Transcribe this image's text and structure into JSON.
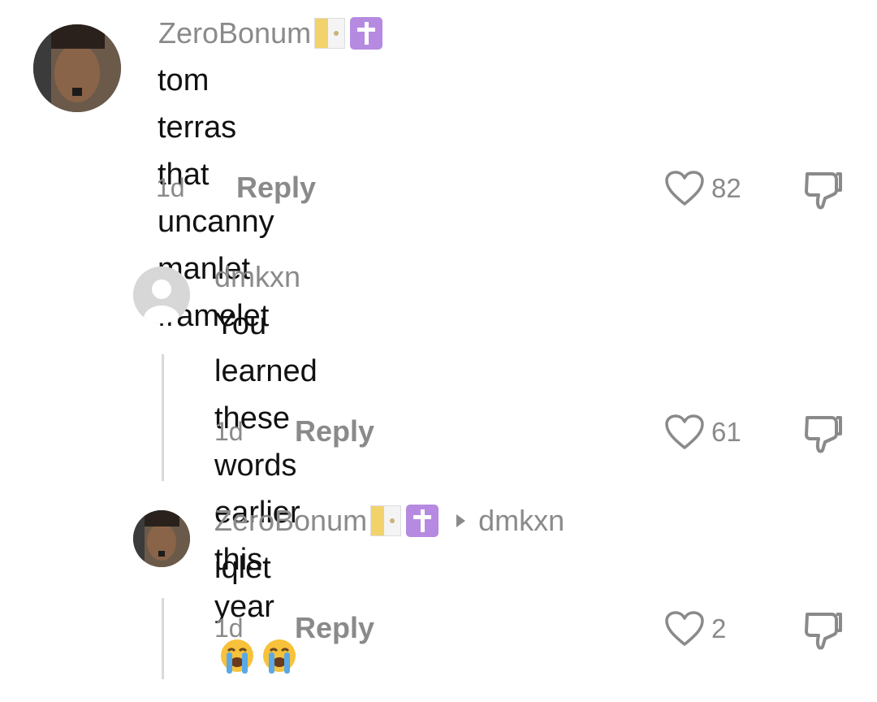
{
  "comments": [
    {
      "username": "ZeroBonum",
      "text_lines": [
        "tom terras that uncanny manlet",
        "framelet"
      ],
      "time": "1d",
      "reply_label": "Reply",
      "likes": "82"
    },
    {
      "username": "dmkxn",
      "text_lines": [
        "You learned these words earlier this",
        "year"
      ],
      "time": "1d",
      "reply_label": "Reply",
      "likes": "61"
    },
    {
      "username": "ZeroBonum",
      "reply_to": "dmkxn",
      "text_lines": [
        "iqlet"
      ],
      "time": "1d",
      "reply_label": "Reply",
      "likes": "2"
    }
  ],
  "icons": {
    "flag": "vatican-flag-icon",
    "cross": "latin-cross-icon",
    "like": "heart-outline-icon",
    "dislike": "thumbs-down-outline-icon",
    "emoji": "loudly-crying-face-emoji"
  },
  "colors": {
    "muted_text": "#8a8a8a",
    "body_text": "#111111",
    "thread_line": "#d9d9d9"
  }
}
